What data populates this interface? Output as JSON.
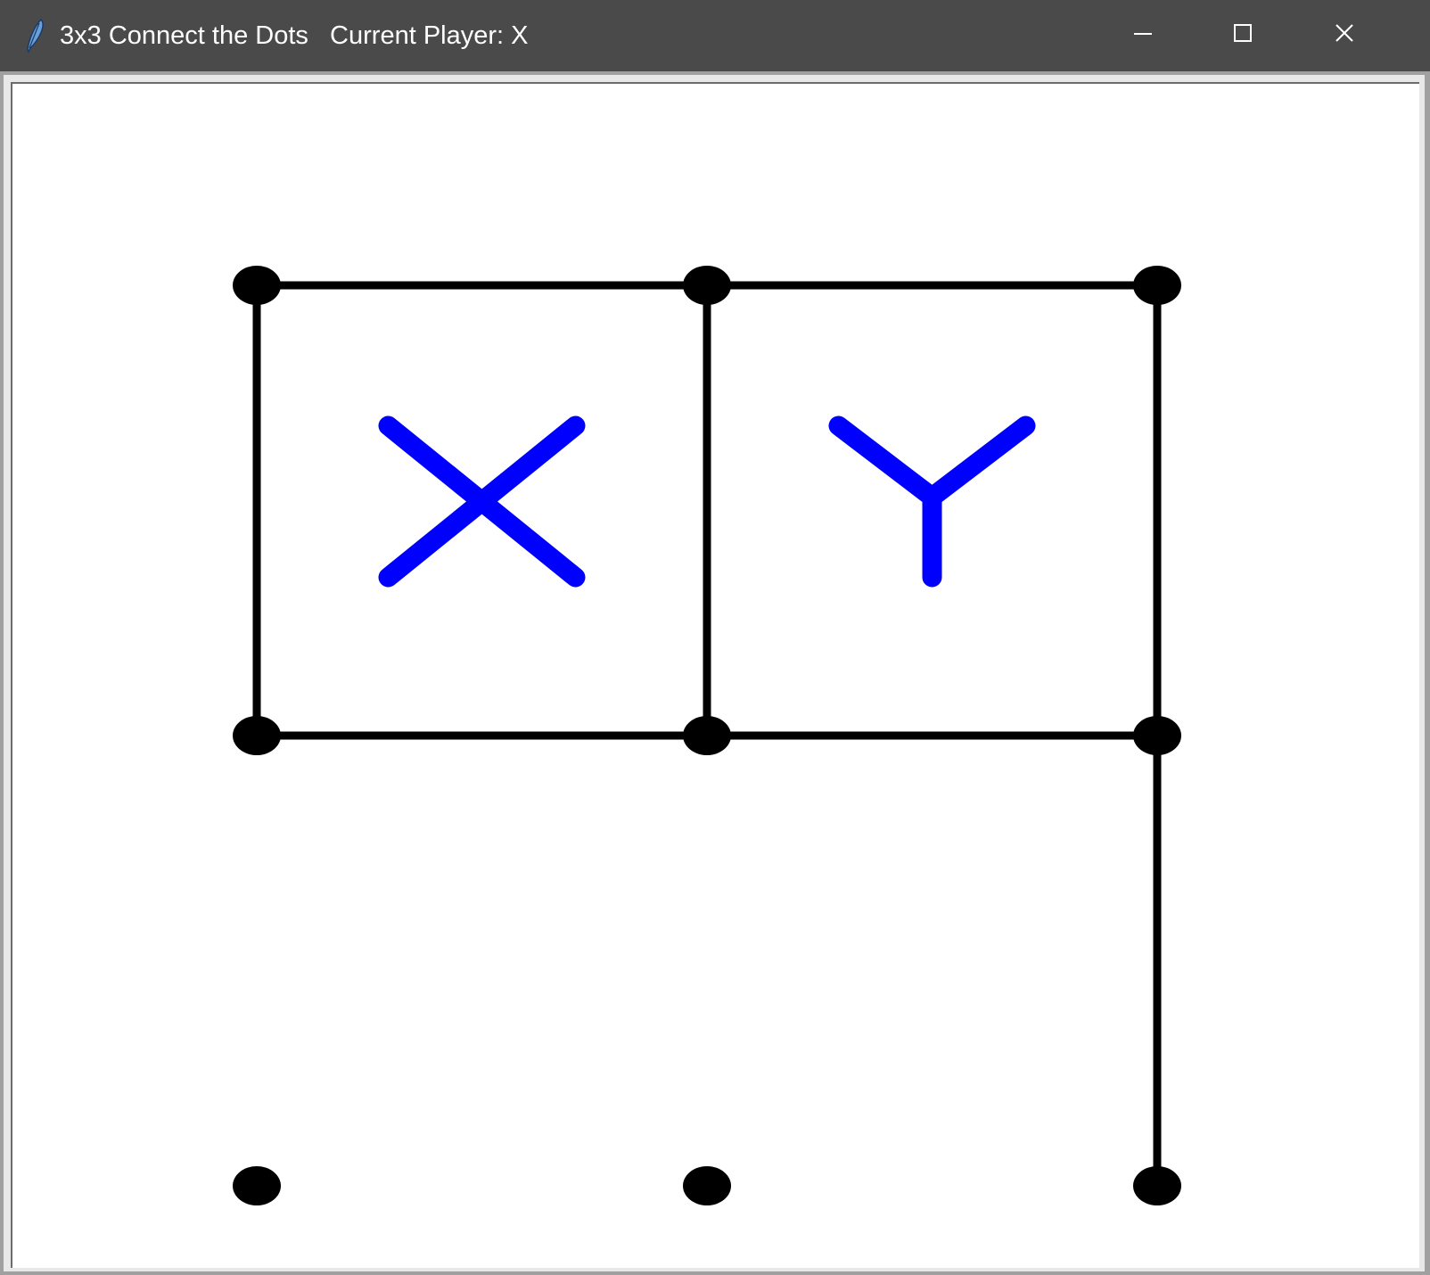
{
  "window": {
    "title": "3x3 Connect the Dots   Current Player: X",
    "icon": "feather-icon",
    "controls": [
      "minimize-icon",
      "maximize-icon",
      "close-icon"
    ]
  },
  "game": {
    "grid_size": 3,
    "current_player": "X",
    "player_color": "#0000ff",
    "line_color": "#000000",
    "dots": [
      {
        "row": 0,
        "col": 0
      },
      {
        "row": 0,
        "col": 1
      },
      {
        "row": 0,
        "col": 2
      },
      {
        "row": 1,
        "col": 0
      },
      {
        "row": 1,
        "col": 1
      },
      {
        "row": 1,
        "col": 2
      },
      {
        "row": 2,
        "col": 0
      },
      {
        "row": 2,
        "col": 1
      },
      {
        "row": 2,
        "col": 2
      }
    ],
    "lines": [
      {
        "from": [
          0,
          0
        ],
        "to": [
          0,
          1
        ]
      },
      {
        "from": [
          0,
          1
        ],
        "to": [
          0,
          2
        ]
      },
      {
        "from": [
          0,
          0
        ],
        "to": [
          1,
          0
        ]
      },
      {
        "from": [
          0,
          1
        ],
        "to": [
          1,
          1
        ]
      },
      {
        "from": [
          0,
          2
        ],
        "to": [
          1,
          2
        ]
      },
      {
        "from": [
          1,
          0
        ],
        "to": [
          1,
          1
        ]
      },
      {
        "from": [
          1,
          1
        ],
        "to": [
          1,
          2
        ]
      },
      {
        "from": [
          1,
          2
        ],
        "to": [
          2,
          2
        ]
      }
    ],
    "boxes": [
      {
        "row": 0,
        "col": 0,
        "owner": "X"
      },
      {
        "row": 0,
        "col": 1,
        "owner": "Y"
      }
    ]
  }
}
